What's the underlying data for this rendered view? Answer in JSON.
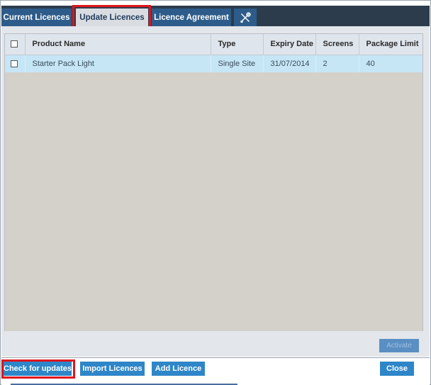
{
  "tabs": [
    {
      "label": "Current Licences",
      "active": false
    },
    {
      "label": "Update Licences",
      "active": true
    },
    {
      "label": "Licence Agreement",
      "active": false
    },
    {
      "icon": "tools-icon"
    }
  ],
  "table": {
    "columns": [
      "",
      "Product Name",
      "Type",
      "Expiry Date",
      "Screens",
      "Package Limit"
    ],
    "rows": [
      {
        "checked": false,
        "product": "Starter Pack Light",
        "type": "Single Site",
        "expiry": "31/07/2014",
        "screens": "2",
        "package_limit": "40"
      }
    ]
  },
  "buttons": {
    "activate": "Activate",
    "check_updates": "Check for updates",
    "import": "Import Licences",
    "add": "Add Licence",
    "close": "Close"
  },
  "colors": {
    "tab_bar": "#2c3c4c",
    "tab": "#2e5c8a",
    "button": "#2e86c8",
    "highlight": "#e0141e",
    "selected_row": "#c6e6f6"
  }
}
